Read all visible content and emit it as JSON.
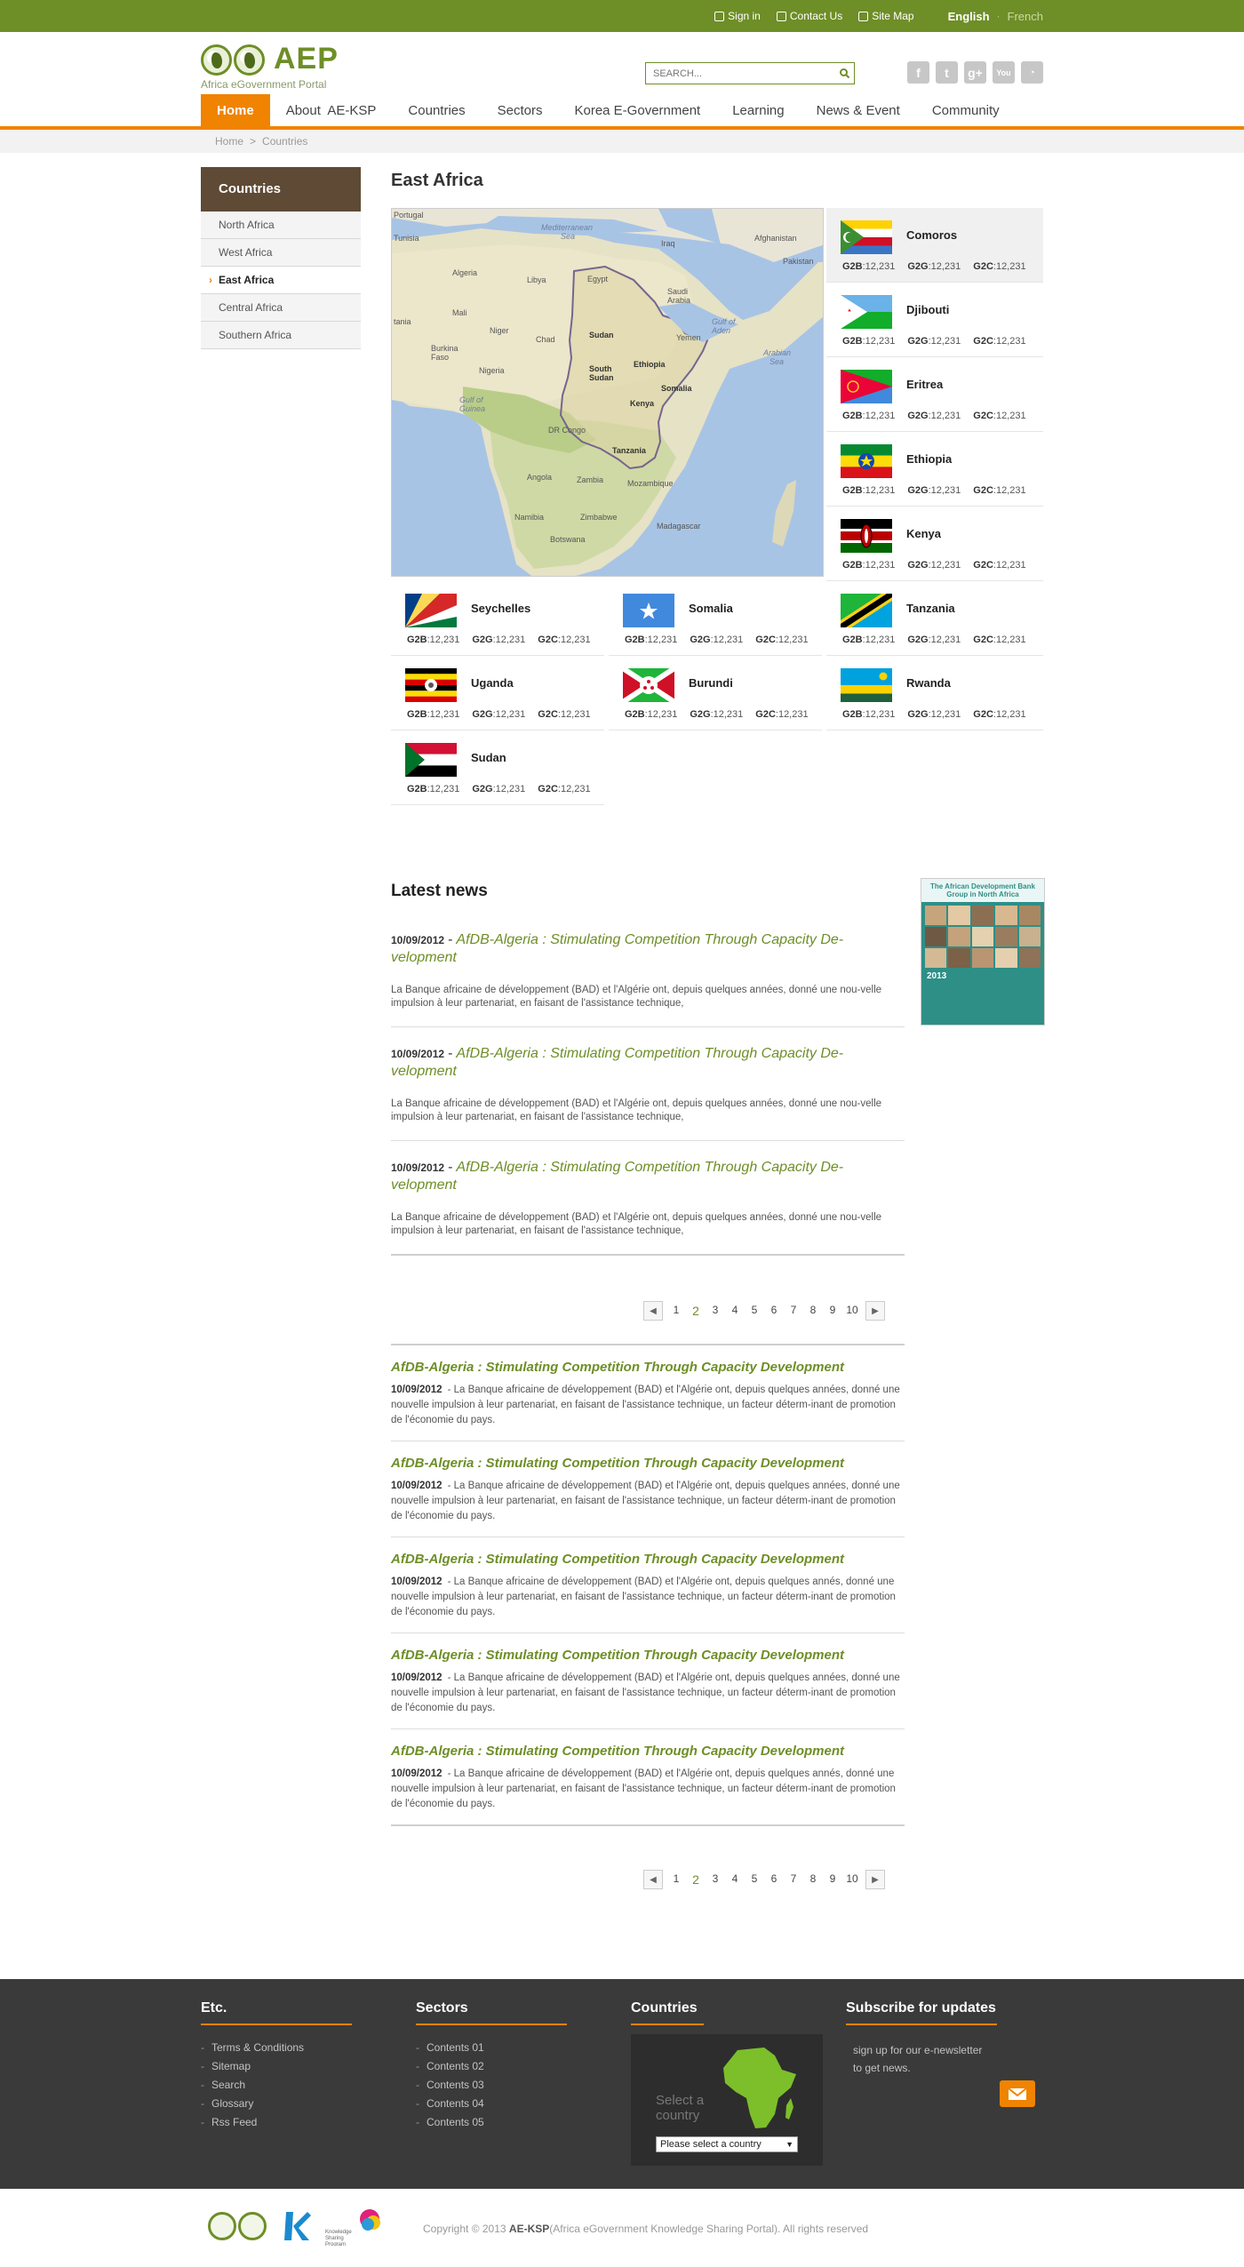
{
  "topbar": {
    "sign_in": "Sign in",
    "contact": "Contact Us",
    "sitemap": "Site Map",
    "lang_current": "English",
    "lang_other": "French"
  },
  "header": {
    "logo_text": "AEP",
    "logo_sub": "Africa eGovernment Portal",
    "search_placeholder": "SEARCH..."
  },
  "nav": [
    "Home",
    "About  AE-KSP",
    "Countries",
    "Sectors",
    "Korea E-Government",
    "Learning",
    "News & Event",
    "Community"
  ],
  "breadcrumb": {
    "home": "Home",
    "current": "Countries"
  },
  "sidebar": {
    "title": "Countries",
    "items": [
      "North Africa",
      "West Africa",
      "East Africa",
      "Central Africa",
      "Southern Africa"
    ]
  },
  "page_title": "East Africa",
  "map_labels": {
    "portugal": "Portugal",
    "med": "Mediterranean\nSea",
    "iraq": "Iraq",
    "afghanistan": "Afghanistan",
    "pakistan": "Pakistan",
    "tunisia": "Tunisia",
    "algeria": "Algeria",
    "libya": "Libya",
    "egypt": "Egypt",
    "saudi": "Saudi\nArabia",
    "mauritania": "Mauritania",
    "mali": "Mali",
    "niger": "Niger",
    "chad": "Chad",
    "sudan": "Sudan",
    "yemen": "Yemen",
    "burkina": "Burkina\nFaso",
    "nigeria": "Nigeria",
    "ethiopia": "Ethiopia",
    "arabian": "Arabian\nSea",
    "ssudan": "South\nSudan",
    "gulf": "Gulf of\nGuinea",
    "somalia": "Somalia",
    "kenya": "Kenya",
    "drc": "DR Congo",
    "tanzania": "Tanzania",
    "angola": "Angola",
    "zambia": "Zambia",
    "mozambique": "Mozambique",
    "namibia": "Namibia",
    "zimbabwe": "Zimbabwe",
    "botswana": "Botswana",
    "madagascar": "Madagascar",
    "gulfaden": "Gulf of\nAden"
  },
  "stats_labels": {
    "g2b": "G2B",
    "g2g": "G2G",
    "g2c": "G2C"
  },
  "countries": [
    {
      "name": "Comoros",
      "g2b": ":12,231",
      "g2g": ":12,231",
      "g2c": ":12,231"
    },
    {
      "name": "Djibouti",
      "g2b": ":12,231",
      "g2g": ":12,231",
      "g2c": ":12,231"
    },
    {
      "name": "Eritrea",
      "g2b": ":12,231",
      "g2g": ":12,231",
      "g2c": ":12,231"
    },
    {
      "name": "Ethiopia",
      "g2b": ":12,231",
      "g2g": ":12,231",
      "g2c": ":12,231"
    },
    {
      "name": "Kenya",
      "g2b": ":12,231",
      "g2g": ":12,231",
      "g2c": ":12,231"
    },
    {
      "name": "Seychelles",
      "g2b": ":12,231",
      "g2g": ":12,231",
      "g2c": ":12,231"
    },
    {
      "name": "Somalia",
      "g2b": ":12,231",
      "g2g": ":12,231",
      "g2c": ":12,231"
    },
    {
      "name": "Tanzania",
      "g2b": ":12,231",
      "g2g": ":12,231",
      "g2c": ":12,231"
    },
    {
      "name": "Uganda",
      "g2b": ":12,231",
      "g2g": ":12,231",
      "g2c": ":12,231"
    },
    {
      "name": "Burundi",
      "g2b": ":12,231",
      "g2g": ":12,231",
      "g2c": ":12,231"
    },
    {
      "name": "Rwanda",
      "g2b": ":12,231",
      "g2g": ":12,231",
      "g2c": ":12,231"
    },
    {
      "name": "Sudan",
      "g2b": ":12,231",
      "g2g": ":12,231",
      "g2c": ":12,231"
    }
  ],
  "latest_news": {
    "title": "Latest news",
    "items": [
      {
        "date": "10/09/2012",
        "title": "AfDB-Algeria : Stimulating Competition Through Capacity De-velopment",
        "excerpt": "La Banque africaine de développement (BAD) et l'Algérie ont, depuis quelques années, donné une nou-velle impulsion à leur partenariat, en faisant de l'assistance technique,"
      },
      {
        "date": "10/09/2012",
        "title": "AfDB-Algeria : Stimulating Competition Through Capacity De-velopment",
        "excerpt": "La Banque africaine de développement (BAD) et l'Algérie ont, depuis quelques années, donné une nou-velle impulsion à leur partenariat, en faisant de l'assistance technique,"
      },
      {
        "date": "10/09/2012",
        "title": "AfDB-Algeria : Stimulating Competition Through Capacity De-velopment",
        "excerpt": "La Banque africaine de développement (BAD) et l'Algérie ont, depuis quelques années, donné une nou-velle impulsion à leur partenariat, en faisant de l'assistance technique,"
      }
    ]
  },
  "promo": {
    "title": "The African Development Bank Group in North Africa",
    "year": "2013"
  },
  "pager": {
    "pages": [
      "1",
      "2",
      "3",
      "4",
      "5",
      "6",
      "7",
      "8",
      "9",
      "10"
    ],
    "current": "2"
  },
  "articles": [
    {
      "title": "AfDB-Algeria : Stimulating Competition Through Capacity Development",
      "date": "10/09/2012",
      "body": "- La Banque africaine de développement (BAD) et l'Algérie ont, depuis quelques années, donné une nouvelle impulsion à leur partenariat, en faisant de l'assistance technique, un facteur déterm-inant de promotion de l'économie du pays."
    },
    {
      "title": "AfDB-Algeria : Stimulating Competition Through Capacity Development",
      "date": "10/09/2012",
      "body": "- La Banque africaine de développement (BAD) et l'Algérie ont, depuis quelques années, donné une nouvelle impulsion à leur partenariat, en faisant de l'assistance technique, un facteur déterm-inant de promotion de l'économie du pays."
    },
    {
      "title": "AfDB-Algeria : Stimulating Competition Through Capacity Development",
      "date": "10/09/2012",
      "body": "- La Banque africaine de développement (BAD) et l'Algérie ont, depuis quelques annés, donné une nouvelle impulsion à leur partenariat, en faisant de l'assistance technique, un facteur déterm-inant de promotion de l'économie du pays."
    },
    {
      "title": "AfDB-Algeria : Stimulating Competition Through Capacity Development",
      "date": "10/09/2012",
      "body": "- La Banque africaine de développement (BAD) et l'Algérie ont, depuis quelques années, donné une nouvelle impulsion à leur partenariat, en faisant de l'assistance technique, un facteur déterm-inant de promotion de l'économie du pays."
    },
    {
      "title": "AfDB-Algeria : Stimulating Competition Through Capacity Development",
      "date": "10/09/2012",
      "body": "- La Banque africaine de développement (BAD) et l'Algérie ont, depuis quelques annés, donné une nouvelle impulsion à leur partenariat, en faisant de l'assistance technique, un facteur déterm-inant de promotion de l'économie du pays."
    }
  ],
  "footer": {
    "etc_title": "Etc.",
    "etc_items": [
      "Terms & Conditions",
      "Sitemap",
      "Search",
      "Glossary",
      "Rss Feed"
    ],
    "sectors_title": "Sectors",
    "sectors_items": [
      "Contents 01",
      "Contents 02",
      "Contents 03",
      "Contents 04",
      "Contents 05"
    ],
    "countries_title": "Countries",
    "select_label": "Select a country",
    "select_value": "Please select a country",
    "subscribe_title": "Subscribe for updates",
    "subscribe_text": "sign up for our e-newsletter to get news."
  },
  "copyright": {
    "prefix": "Copyright © 2013 ",
    "brand": "AE-KSP",
    "suffix": "(Africa eGovernment Knowledge Sharing Portal). All rights reserved"
  },
  "colors": {
    "brand_green": "#6e8e27",
    "accent_orange": "#f08300",
    "sidebar_brown": "#5e4a35",
    "footer_bg": "#3a3a3a"
  }
}
